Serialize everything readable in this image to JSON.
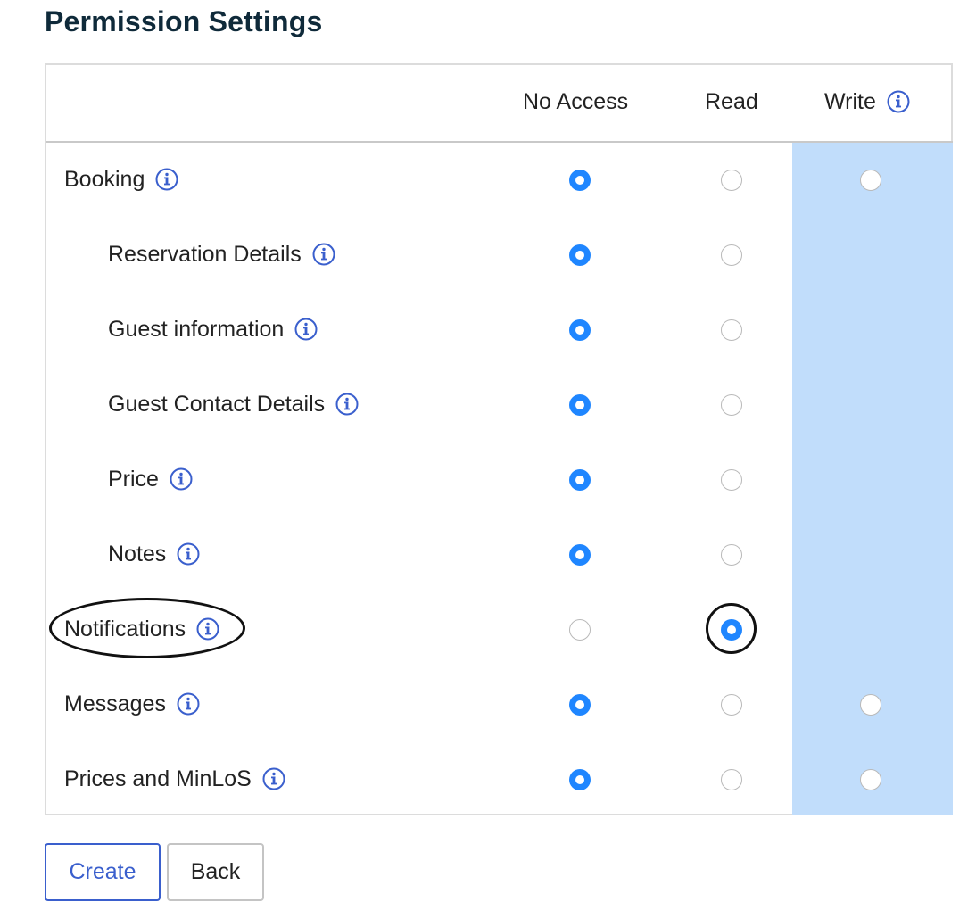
{
  "title": "Permission Settings",
  "columns": {
    "no_access": "No Access",
    "read": "Read",
    "write": "Write"
  },
  "rows": [
    {
      "label": "Booking",
      "indent": false,
      "selected": "no_access",
      "has_write": true
    },
    {
      "label": "Reservation Details",
      "indent": true,
      "selected": "no_access",
      "has_write": false
    },
    {
      "label": "Guest information",
      "indent": true,
      "selected": "no_access",
      "has_write": false
    },
    {
      "label": "Guest Contact Details",
      "indent": true,
      "selected": "no_access",
      "has_write": false
    },
    {
      "label": "Price",
      "indent": true,
      "selected": "no_access",
      "has_write": false
    },
    {
      "label": "Notes",
      "indent": true,
      "selected": "no_access",
      "has_write": false
    },
    {
      "label": "Notifications",
      "indent": false,
      "selected": "read",
      "has_write": false
    },
    {
      "label": "Messages",
      "indent": false,
      "selected": "no_access",
      "has_write": true
    },
    {
      "label": "Prices and MinLoS",
      "indent": false,
      "selected": "no_access",
      "has_write": true
    }
  ],
  "buttons": {
    "create": "Create",
    "back": "Back"
  },
  "colors": {
    "accent": "#1f86ff",
    "write_column": "#c1ddfb",
    "info_icon": "#3a5fcd",
    "title": "#0f2a3a"
  },
  "icons": {
    "info": "info-icon"
  }
}
